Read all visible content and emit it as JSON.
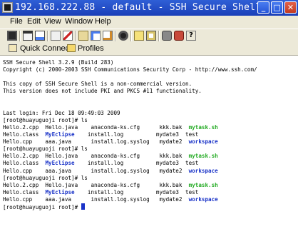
{
  "window": {
    "title": "192.168.222.88 - default - SSH Secure Shell",
    "min_label": "_",
    "max_label": "□",
    "close_label": "✕"
  },
  "menu": {
    "items": [
      "File",
      "Edit",
      "View",
      "Window",
      "Help"
    ]
  },
  "toolbar": {
    "icons": [
      "save-icon",
      "print-icon",
      "print-preview-icon",
      "copy-icon",
      "cut-icon",
      "paste-icon",
      "find-icon",
      "new-terminal-icon",
      "new-file-transfer-icon",
      "settings-icon",
      "connect-icon",
      "help-icon"
    ]
  },
  "linkbar": {
    "quick_connect": "Quick Connect",
    "profiles": "Profiles"
  },
  "terminal": {
    "lines": [
      {
        "t": "SSH Secure Shell 3.2.9 (Build 283)"
      },
      {
        "t": "Copyright (c) 2000-2003 SSH Communications Security Corp - http://www.ssh.com/"
      },
      {
        "t": ""
      },
      {
        "t": "This copy of SSH Secure Shell is a non-commercial version."
      },
      {
        "t": "This version does not include PKI and PKCS #11 functionality."
      },
      {
        "t": ""
      },
      {
        "t": ""
      },
      {
        "t": "Last login: Fri Dec 18 09:49:03 2009"
      },
      {
        "t": "[root@huayuguoji root]# ls"
      },
      {
        "t": "Hello.2.cpp  Hello.java    anaconda-ks.cfg      kkk.bak  ",
        "g": "mytask.sh"
      },
      {
        "t": "Hello.class  ",
        "b": "MyEclipse",
        "t2": "    install.log          mydate3  test"
      },
      {
        "t": "Hello.cpp    aaa.java      install.log.syslog   mydate2  ",
        "b2": "workspace"
      },
      {
        "t": "[root@huayuguoji root]# ls"
      },
      {
        "t": "Hello.2.cpp  Hello.java    anaconda-ks.cfg      kkk.bak  ",
        "g": "mytask.sh"
      },
      {
        "t": "Hello.class  ",
        "b": "MyEclipse",
        "t2": "    install.log          mydate3  test"
      },
      {
        "t": "Hello.cpp    aaa.java      install.log.syslog   mydate2  ",
        "b2": "workspace"
      },
      {
        "t": "[root@huayuguoji root]# ls"
      },
      {
        "t": "Hello.2.cpp  Hello.java    anaconda-ks.cfg      kkk.bak  ",
        "g": "mytask.sh"
      },
      {
        "t": "Hello.class  ",
        "b": "MyEclipse",
        "t2": "    install.log          mydate3  test"
      },
      {
        "t": "Hello.cpp    aaa.java      install.log.syslog   mydate2  ",
        "b2": "workspace"
      },
      {
        "t": "[root@huayuguoji root]# ",
        "cursor": true
      }
    ]
  },
  "colors": {
    "title_bar": "#1a3fb8",
    "green_file": "#22aa22",
    "blue_dir": "#1a33c8"
  }
}
